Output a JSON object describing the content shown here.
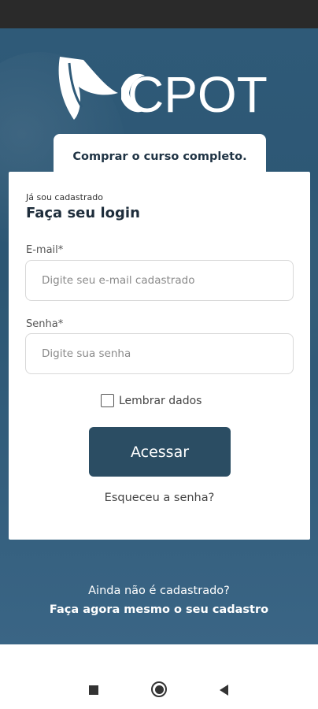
{
  "brand": {
    "logo_text": "CPOT",
    "accent_color": "#2b4d63",
    "hero_color": "#2f5a78"
  },
  "top": {
    "buy_label": "Comprar o curso completo."
  },
  "login": {
    "kicker": "Já sou cadastrado",
    "title": "Faça seu login",
    "email_label": "E-mail*",
    "email_placeholder": "Digite seu e-mail cadastrado",
    "email_value": "",
    "password_label": "Senha*",
    "password_placeholder": "Digite sua senha",
    "password_value": "",
    "remember_label": "Lembrar dados",
    "remember_checked": false,
    "submit_label": "Acessar",
    "forgot_label": "Esqueceu a senha?"
  },
  "signup": {
    "question": "Ainda não é cadastrado?",
    "link": "Faça agora mesmo o seu cadastro"
  },
  "navbar": {
    "icons": [
      "recent-apps-icon",
      "home-icon",
      "back-icon"
    ]
  }
}
